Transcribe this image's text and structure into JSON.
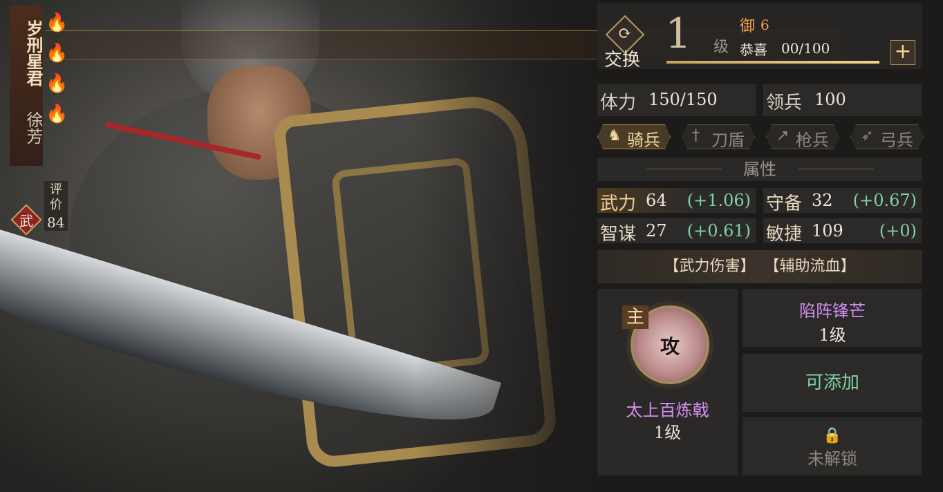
{
  "general": {
    "title": "岁刑星君",
    "name": "徐芳",
    "stars": 4,
    "rating_label": "评价",
    "rating_value": "84",
    "class_label": "武"
  },
  "header": {
    "swap_label": "交换",
    "level": "1",
    "level_unit": "级",
    "defense_label": "御",
    "defense_value": "6",
    "exp_label": "恭喜",
    "exp_value": "00/100",
    "exp_fraction": 1.0
  },
  "stats": {
    "hp_label": "体力",
    "hp_value": "150/150",
    "troops_label": "领兵",
    "troops_value": "100"
  },
  "troop_types": [
    {
      "label": "骑兵",
      "icon": "horse-icon",
      "active": true
    },
    {
      "label": "刀盾",
      "icon": "sword-icon",
      "active": false
    },
    {
      "label": "枪兵",
      "icon": "spear-icon",
      "active": false
    },
    {
      "label": "弓兵",
      "icon": "bow-icon",
      "active": false
    }
  ],
  "attributes": {
    "header": "属性",
    "items": [
      {
        "name": "武力",
        "value": "64",
        "bonus": "(+1.06)"
      },
      {
        "name": "守备",
        "value": "32",
        "bonus": "(+0.67)"
      },
      {
        "name": "智谋",
        "value": "27",
        "bonus": "(+0.61)"
      },
      {
        "name": "敏捷",
        "value": "109",
        "bonus": "(+0)"
      }
    ]
  },
  "tags": [
    "【武力伤害】",
    "【辅助流血】"
  ],
  "skills": {
    "main_tag": "主",
    "main_char": "攻",
    "main_name": "太上百炼戟",
    "main_level": "1级",
    "slot1_name": "陷阵锋芒",
    "slot1_level": "1级",
    "slot2_label": "可添加",
    "slot3_label": "未解锁"
  },
  "colors": {
    "accent_gold": "#c9a45f",
    "bonus_green": "#7fd3a1",
    "skill_purple": "#d38ff0",
    "defense_orange": "#f0a64a"
  }
}
